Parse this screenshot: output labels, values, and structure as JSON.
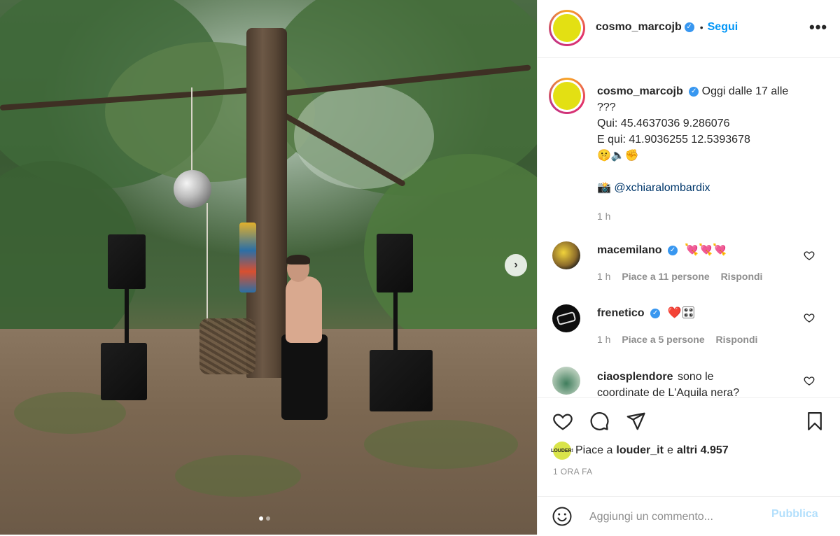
{
  "header": {
    "username": "cosmo_marcojb",
    "follow_label": "Segui",
    "separator": "•",
    "more_label": "•••"
  },
  "caption": {
    "username": "cosmo_marcojb",
    "line1": "Oggi dalle 17 alle",
    "line2": "???",
    "line3": "Qui: 45.4637036 9.286076",
    "line4": "E qui: 41.9036255 12.5393678",
    "emojis": "🤫🔈✊",
    "camera_emoji": "📸",
    "mention": "@xchiaralombardix",
    "time": "1 h"
  },
  "comments": [
    {
      "username": "macemilano",
      "verified": true,
      "text": "💘💘💘",
      "time": "1 h",
      "likes": "Piace a 11 persone",
      "reply": "Rispondi"
    },
    {
      "username": "frenetico",
      "verified": true,
      "text": "❤️🎛",
      "time": "1 h",
      "likes": "Piace a 5 persone",
      "reply": "Rispondi"
    },
    {
      "username": "ciaosplendore",
      "verified": false,
      "text_line1": "sono le",
      "text_line2": "coordinate de L'Aquila nera?"
    }
  ],
  "likes": {
    "prefix": "Piace a",
    "user": "louder_it",
    "middle": "e",
    "others": "altri 4.957",
    "avatar_text": "LOUDER!"
  },
  "timestamp": "1 ORA FA",
  "add_comment": {
    "placeholder": "Aggiungi un commento...",
    "publish_label": "Pubblica"
  },
  "carousel": {
    "current": 1,
    "total": 2
  },
  "colors": {
    "link_blue": "#0095f6",
    "verified_blue": "#3897f0",
    "avatar_yellow": "#e3e013",
    "publish_disabled": "#b2dffc",
    "meta_grey": "#8e8e8e"
  }
}
